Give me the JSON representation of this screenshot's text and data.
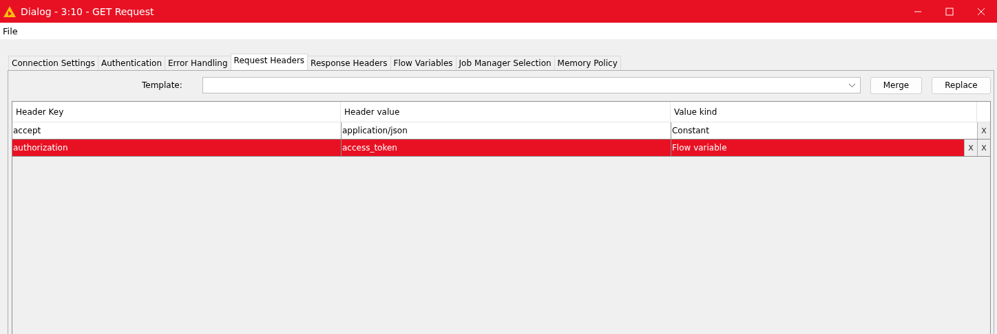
{
  "window": {
    "title": "Dialog - 3:10 - GET Request"
  },
  "menu": [
    "File"
  ],
  "tabs": [
    {
      "label": "Connection Settings",
      "selected": false
    },
    {
      "label": "Authentication",
      "selected": false
    },
    {
      "label": "Error Handling",
      "selected": false
    },
    {
      "label": "Request Headers",
      "selected": true
    },
    {
      "label": "Response Headers",
      "selected": false
    },
    {
      "label": "Flow Variables",
      "selected": false
    },
    {
      "label": "Job Manager Selection",
      "selected": false
    },
    {
      "label": "Memory Policy",
      "selected": false
    }
  ],
  "template": {
    "label": "Template:"
  },
  "buttons": [
    "Merge",
    "Replace"
  ],
  "table": {
    "columns": [
      "Header Key",
      "Header value",
      "Value kind"
    ],
    "rows": [
      {
        "cells": [
          "accept",
          "application/json",
          "Constant"
        ],
        "selected": false,
        "actions": [
          "X"
        ]
      },
      {
        "cells": [
          "authorization",
          "access_token",
          "Flow variable"
        ],
        "selected": true,
        "actions": [
          "X",
          "X"
        ]
      }
    ]
  }
}
